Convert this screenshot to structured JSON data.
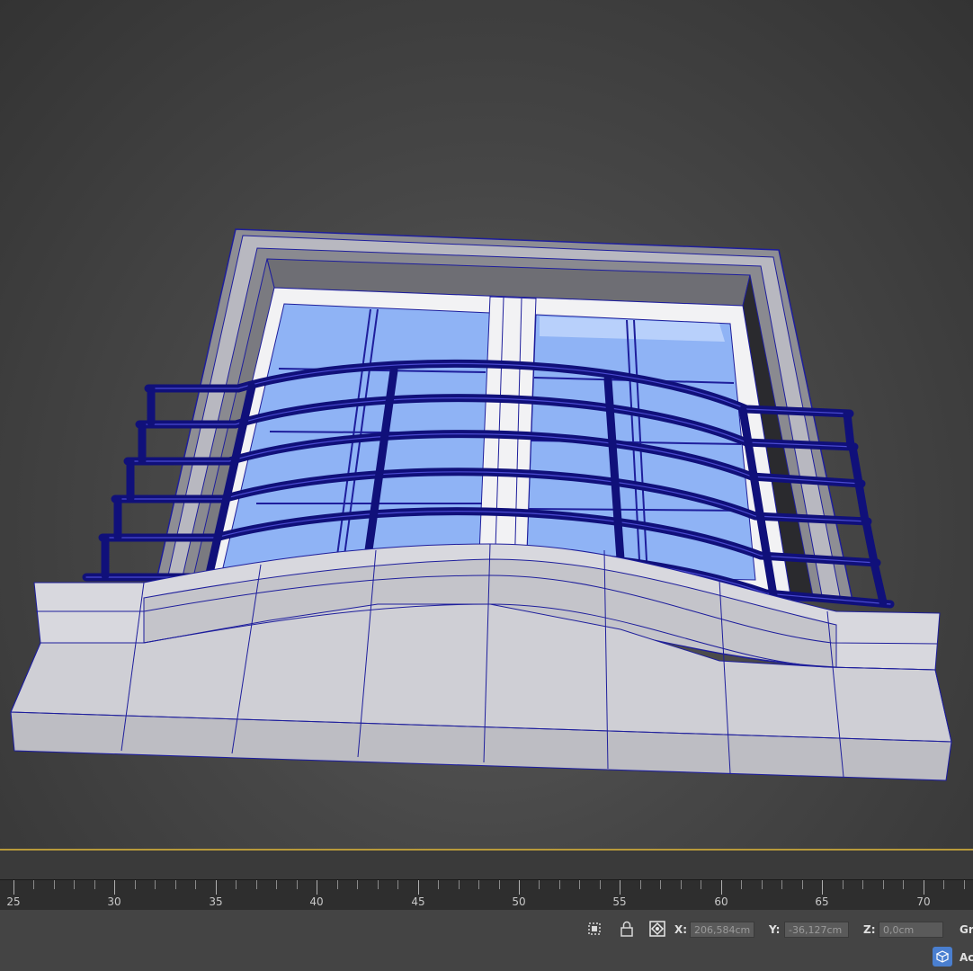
{
  "viewport": {
    "label": "3D viewport",
    "model": "window-with-balcony",
    "colors": {
      "background": "#474747",
      "wireframe": "#1e1e9c",
      "railing": "#10107a",
      "glass": "#8fb3f5",
      "stone": "#c9c9cf",
      "frame_white": "#f2f2f4"
    }
  },
  "timeline": {
    "ticks": [
      {
        "label": "25"
      },
      {
        "label": "30"
      },
      {
        "label": "35"
      },
      {
        "label": "40"
      },
      {
        "label": "45"
      },
      {
        "label": "50"
      },
      {
        "label": "55"
      },
      {
        "label": "60"
      },
      {
        "label": "65"
      },
      {
        "label": "70"
      }
    ]
  },
  "status_bar": {
    "icons": [
      "selection-region-icon",
      "lock-icon",
      "absolute-mode-icon"
    ],
    "x_label": "X:",
    "x_value": "206,584cm",
    "y_label": "Y:",
    "y_value": "-36,127cm",
    "z_label": "Z:",
    "z_value": "0,0cm",
    "grid_label_clip": "Gr",
    "addtime_icon": "cube-key-icon",
    "addtime_label_clip": "Ac"
  }
}
